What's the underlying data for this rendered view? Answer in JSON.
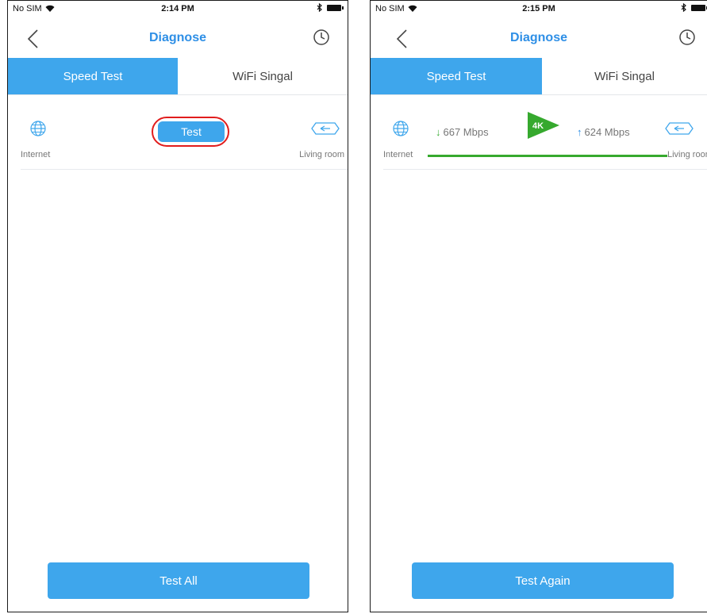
{
  "left": {
    "status": {
      "carrier": "No SIM",
      "time": "2:14 PM"
    },
    "nav": {
      "title": "Diagnose"
    },
    "tabs": [
      {
        "label": "Speed Test",
        "active": true
      },
      {
        "label": "WiFi Singal",
        "active": false
      }
    ],
    "device": {
      "source_label": "Internet",
      "target_label": "Living room",
      "test_button": "Test"
    },
    "bottom_button": "Test All"
  },
  "right": {
    "status": {
      "carrier": "No SIM",
      "time": "2:15 PM"
    },
    "nav": {
      "title": "Diagnose"
    },
    "tabs": [
      {
        "label": "Speed Test",
        "active": true
      },
      {
        "label": "WiFi Singal",
        "active": false
      }
    ],
    "device": {
      "source_label": "Internet",
      "target_label": "Living room",
      "download": "667 Mbps",
      "upload": "624 Mbps",
      "badge": "4K"
    },
    "bottom_button": "Test Again"
  },
  "colors": {
    "accent": "#3ea6ec",
    "title": "#2e8fe6",
    "good": "#36a92e",
    "highlight": "#e11d1d"
  },
  "icons": [
    "back-arrow-icon",
    "clock-icon",
    "globe-icon",
    "router-icon",
    "play-4k-icon",
    "wifi-icon",
    "bluetooth-icon",
    "battery-icon"
  ]
}
